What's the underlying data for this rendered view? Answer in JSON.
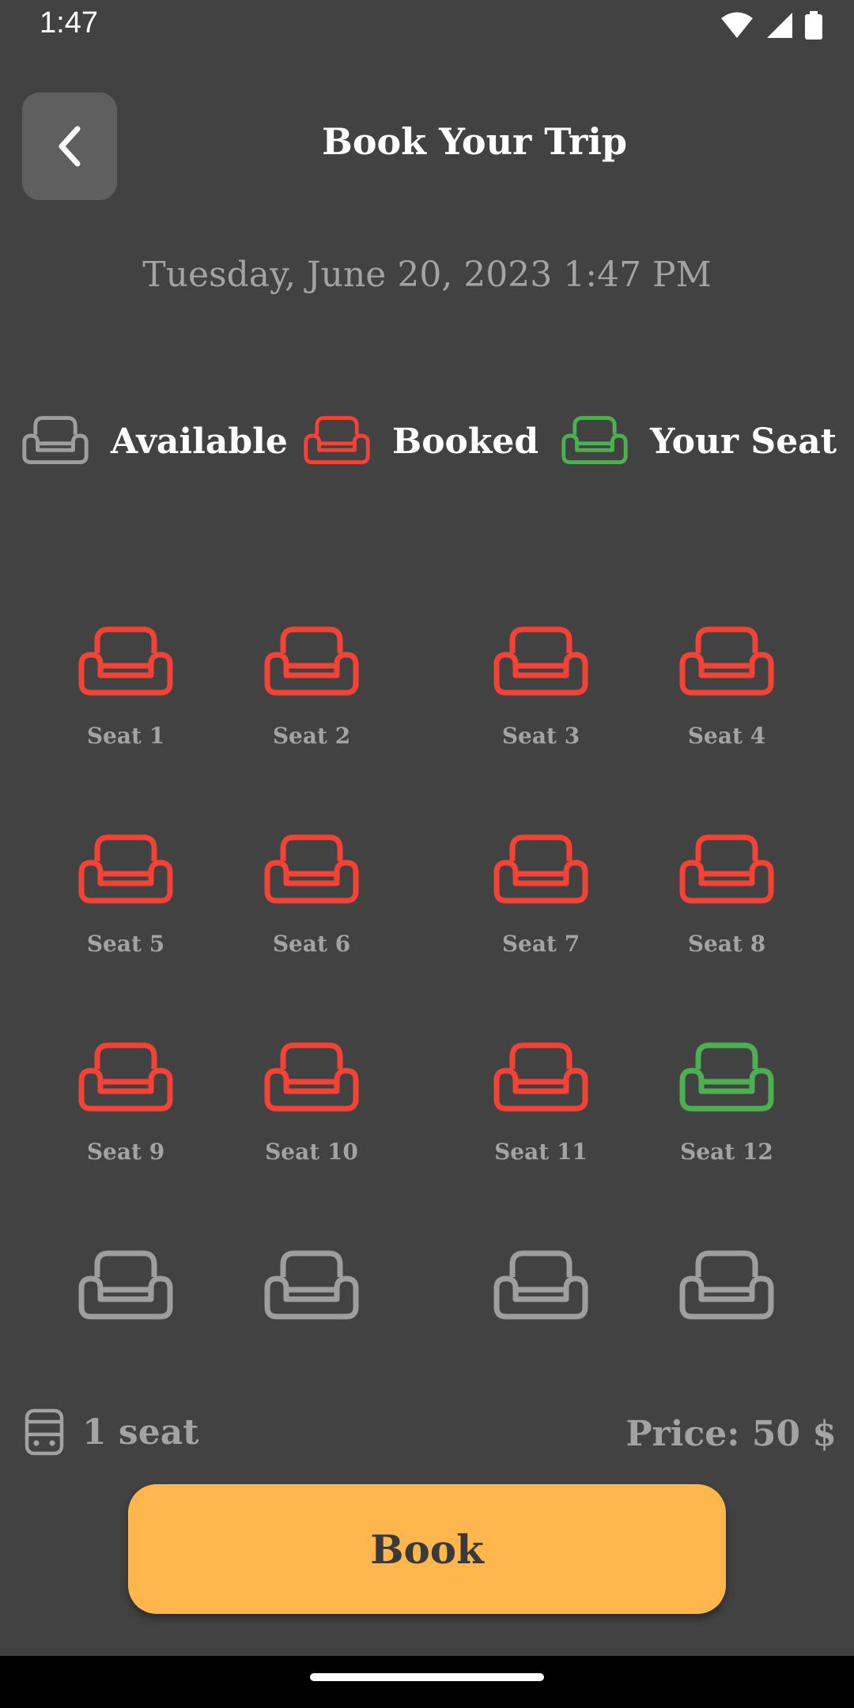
{
  "status_bar": {
    "time": "1:47"
  },
  "header": {
    "title": "Book Your Trip"
  },
  "date_text": "Tuesday, June 20, 2023 1:47 PM",
  "colors": {
    "available": "#9e9e9e",
    "booked": "#f44336",
    "selected": "#4caf50",
    "accent": "#ffb74d"
  },
  "legend": [
    {
      "label": "Available",
      "status": "available",
      "icon": "armchair-icon"
    },
    {
      "label": "Booked",
      "status": "booked",
      "icon": "armchair-icon"
    },
    {
      "label": "Your Seat",
      "status": "selected",
      "icon": "armchair-icon"
    }
  ],
  "seats": [
    {
      "label": "Seat 1",
      "status": "booked"
    },
    {
      "label": "Seat 2",
      "status": "booked"
    },
    {
      "label": "Seat 3",
      "status": "booked"
    },
    {
      "label": "Seat 4",
      "status": "booked"
    },
    {
      "label": "Seat 5",
      "status": "booked"
    },
    {
      "label": "Seat 6",
      "status": "booked"
    },
    {
      "label": "Seat 7",
      "status": "booked"
    },
    {
      "label": "Seat 8",
      "status": "booked"
    },
    {
      "label": "Seat 9",
      "status": "booked"
    },
    {
      "label": "Seat 10",
      "status": "booked"
    },
    {
      "label": "Seat 11",
      "status": "booked"
    },
    {
      "label": "Seat 12",
      "status": "selected"
    },
    {
      "label": "",
      "status": "available"
    },
    {
      "label": "",
      "status": "available"
    },
    {
      "label": "",
      "status": "available"
    },
    {
      "label": "",
      "status": "available"
    }
  ],
  "summary": {
    "seat_count": "1 seat",
    "price": "Price: 50 $",
    "icon": "bus-icon"
  },
  "book_button": {
    "label": "Book"
  }
}
